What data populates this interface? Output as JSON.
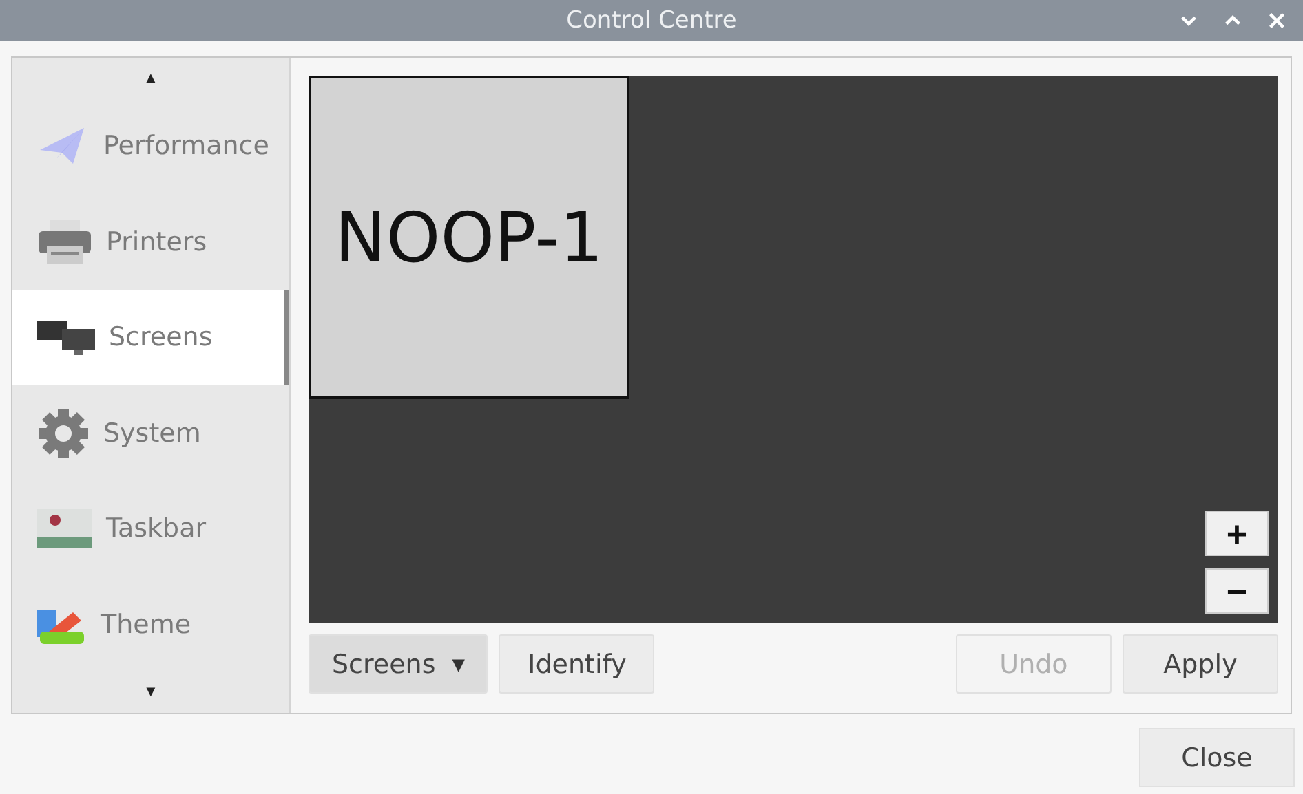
{
  "window": {
    "title": "Control Centre",
    "controls": [
      {
        "kind": "minimize"
      },
      {
        "kind": "maximize"
      },
      {
        "kind": "close"
      }
    ]
  },
  "sidebar": {
    "scroll_up": "▲",
    "scroll_down": "▼",
    "items": [
      {
        "label": "Performance",
        "kind": "plane",
        "selected": false
      },
      {
        "label": "Printers",
        "kind": "printer",
        "selected": false
      },
      {
        "label": "Screens",
        "kind": "screens",
        "selected": true
      },
      {
        "label": "System",
        "kind": "gear",
        "selected": false
      },
      {
        "label": "Taskbar",
        "kind": "taskbar",
        "selected": false
      },
      {
        "label": "Theme",
        "kind": "theme",
        "selected": false
      }
    ]
  },
  "canvas": {
    "screens": [
      {
        "label": "NOOP-1"
      }
    ],
    "zoom_in": "+",
    "zoom_out": "−"
  },
  "buttons": [
    {
      "label": "Screens",
      "kind": "menu",
      "disabled": false,
      "caret": "▼"
    },
    {
      "label": "Identify",
      "kind": "plain",
      "disabled": false
    },
    {
      "label": "Undo",
      "kind": "plain",
      "disabled": true
    },
    {
      "label": "Apply",
      "kind": "plain",
      "disabled": false
    }
  ],
  "close_button": "Close"
}
